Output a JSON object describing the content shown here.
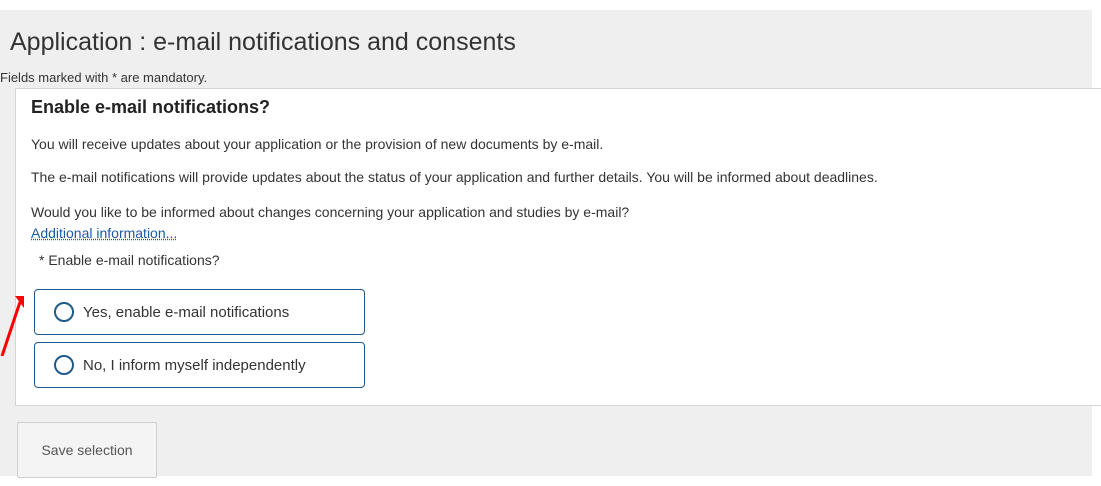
{
  "header": {
    "title": "Application : e-mail notifications and consents",
    "mandatory_note": "Fields marked with * are mandatory."
  },
  "panel": {
    "heading": "Enable e-mail notifications?",
    "paragraphs": [
      "You will receive updates about your application or the provision of new documents by e-mail.",
      "The e-mail notifications will provide updates about the status of your application and further details. You will be informed about deadlines.",
      "Would you like to be informed about changes concerning your application and studies by e-mail?"
    ],
    "info_link": "Additional information...",
    "field_label": "* Enable e-mail notifications?",
    "options": [
      {
        "label": "Yes, enable e-mail notifications",
        "selected": false
      },
      {
        "label": "No, I inform myself independently",
        "selected": false
      }
    ]
  },
  "actions": {
    "save_label": "Save selection"
  },
  "colors": {
    "accent": "#1f5a8e",
    "link": "#1a5aa8",
    "annotation_arrow": "#ff0000",
    "background": "#efefef"
  }
}
